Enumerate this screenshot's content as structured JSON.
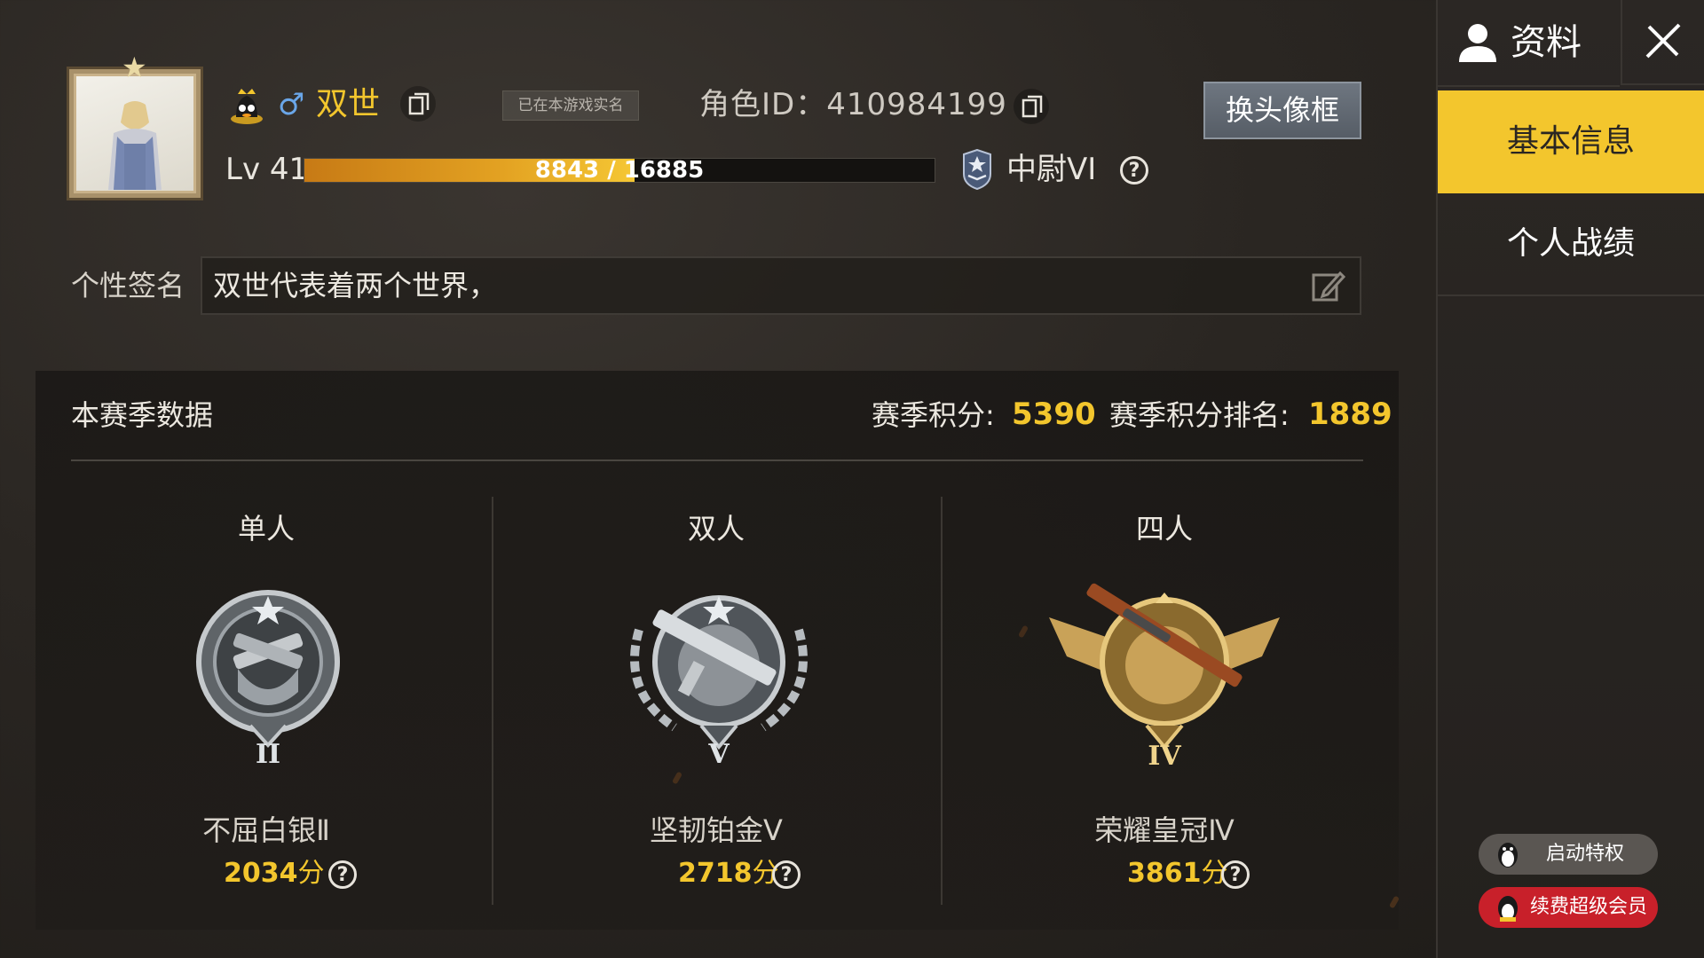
{
  "header": {
    "player_name": "双世",
    "realname_tag": "已在本游戏实名",
    "role_id_label": "角色ID：",
    "role_id_value": "410984199",
    "change_frame_button": "换头像框",
    "level_label": "Lv",
    "level_value": "41",
    "xp_text": "8843 / 16885",
    "xp_progress": 0.5237,
    "tier_label": "中尉VI",
    "help_glyph": "?"
  },
  "signature": {
    "label": "个性签名",
    "value": "双世代表着两个世界，"
  },
  "season": {
    "title": "本赛季数据",
    "points_label": "赛季积分:",
    "points_value": "5390",
    "rank_label": "赛季积分排名:",
    "rank_value": "1889",
    "modes": [
      {
        "title": "单人",
        "tier": "不屈白银Ⅱ",
        "score": "2034",
        "unit": "分",
        "badge_icon": "silver-badge-icon"
      },
      {
        "title": "双人",
        "tier": "坚韧铂金Ⅴ",
        "score": "2718",
        "unit": "分",
        "badge_icon": "platinum-badge-icon"
      },
      {
        "title": "四人",
        "tier": "荣耀皇冠Ⅳ",
        "score": "3861",
        "unit": "分",
        "badge_icon": "crown-badge-icon"
      }
    ]
  },
  "sidebar": {
    "title": "资料",
    "tabs": [
      {
        "label": "基本信息",
        "active": true
      },
      {
        "label": "个人战绩",
        "active": false
      }
    ],
    "privilege_button": "启动特权",
    "vip_button": "续费超级会员"
  },
  "colors": {
    "accent_gold": "#f3c62d",
    "vip_red": "#c8202a",
    "gender_blue": "#6aa6e8"
  }
}
